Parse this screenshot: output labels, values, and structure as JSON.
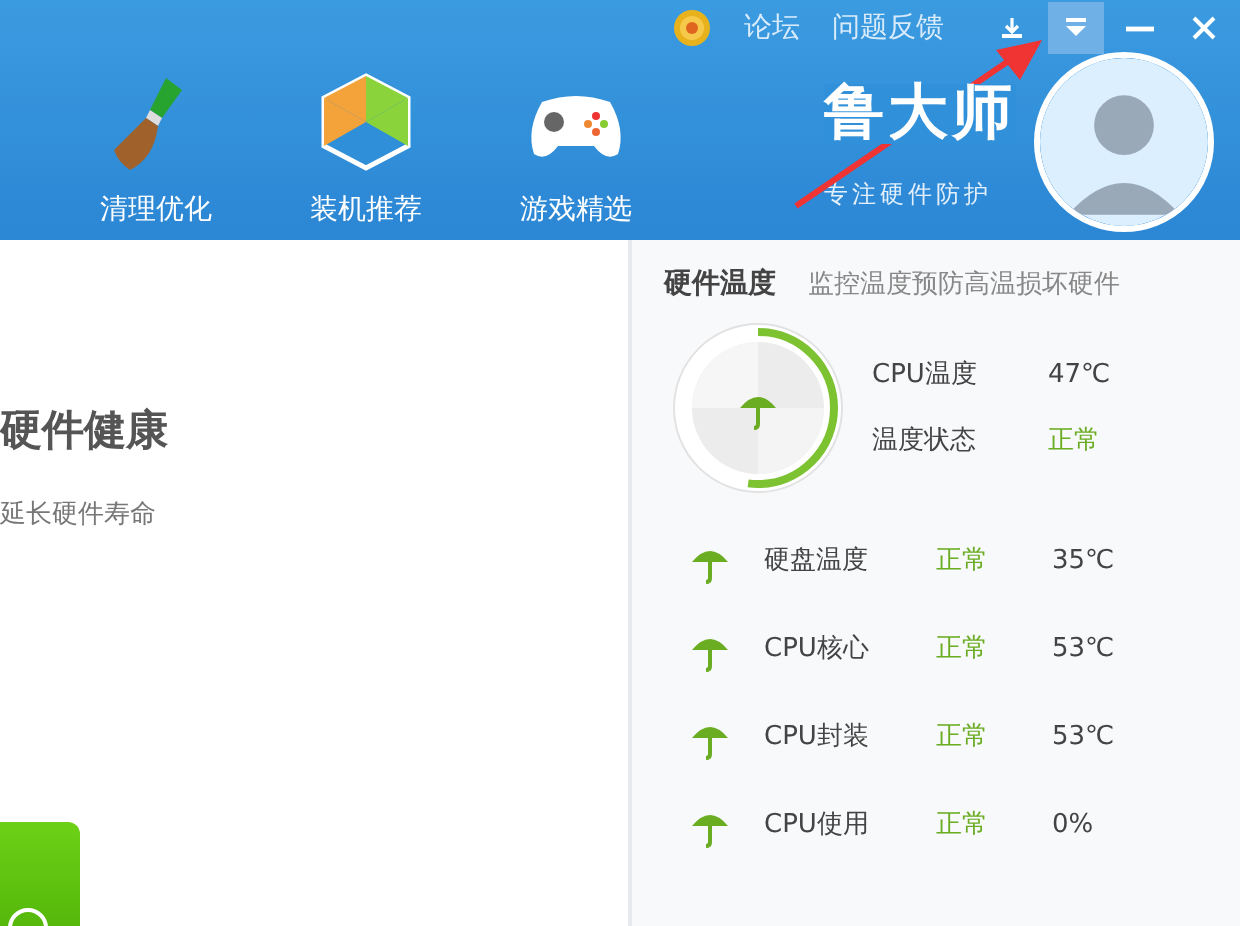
{
  "top_bar": {
    "links": [
      {
        "label": "论坛"
      },
      {
        "label": "问题反馈"
      }
    ],
    "buttons": [
      {
        "kind": "download",
        "highlighted": false
      },
      {
        "kind": "dropdown",
        "highlighted": true
      },
      {
        "kind": "minimize",
        "highlighted": false
      },
      {
        "kind": "close",
        "highlighted": false
      }
    ]
  },
  "nav": [
    {
      "label": "清理优化",
      "kind": "broom"
    },
    {
      "label": "装机推荐",
      "kind": "cube"
    },
    {
      "label": "游戏精选",
      "kind": "gamepad"
    }
  ],
  "brand": {
    "name": "鲁大师",
    "tagline": "专注硬件防护"
  },
  "main": {
    "title": "硬件健康",
    "subtitle": "延长硬件寿命"
  },
  "temperature": {
    "title": "硬件温度",
    "description": "监控温度预防高温损坏硬件",
    "gauge": {
      "level": 0.52
    },
    "cpu": [
      {
        "label": "CPU温度",
        "value": "47℃",
        "kind": "reading"
      },
      {
        "label": "温度状态",
        "value": "正常",
        "kind": "status"
      }
    ],
    "rows": [
      {
        "name": "硬盘温度",
        "status": "正常",
        "value": "35℃"
      },
      {
        "name": "CPU核心",
        "status": "正常",
        "value": "53℃"
      },
      {
        "name": "CPU封装",
        "status": "正常",
        "value": "53℃"
      },
      {
        "name": "CPU使用",
        "status": "正常",
        "value": "0%"
      }
    ]
  }
}
